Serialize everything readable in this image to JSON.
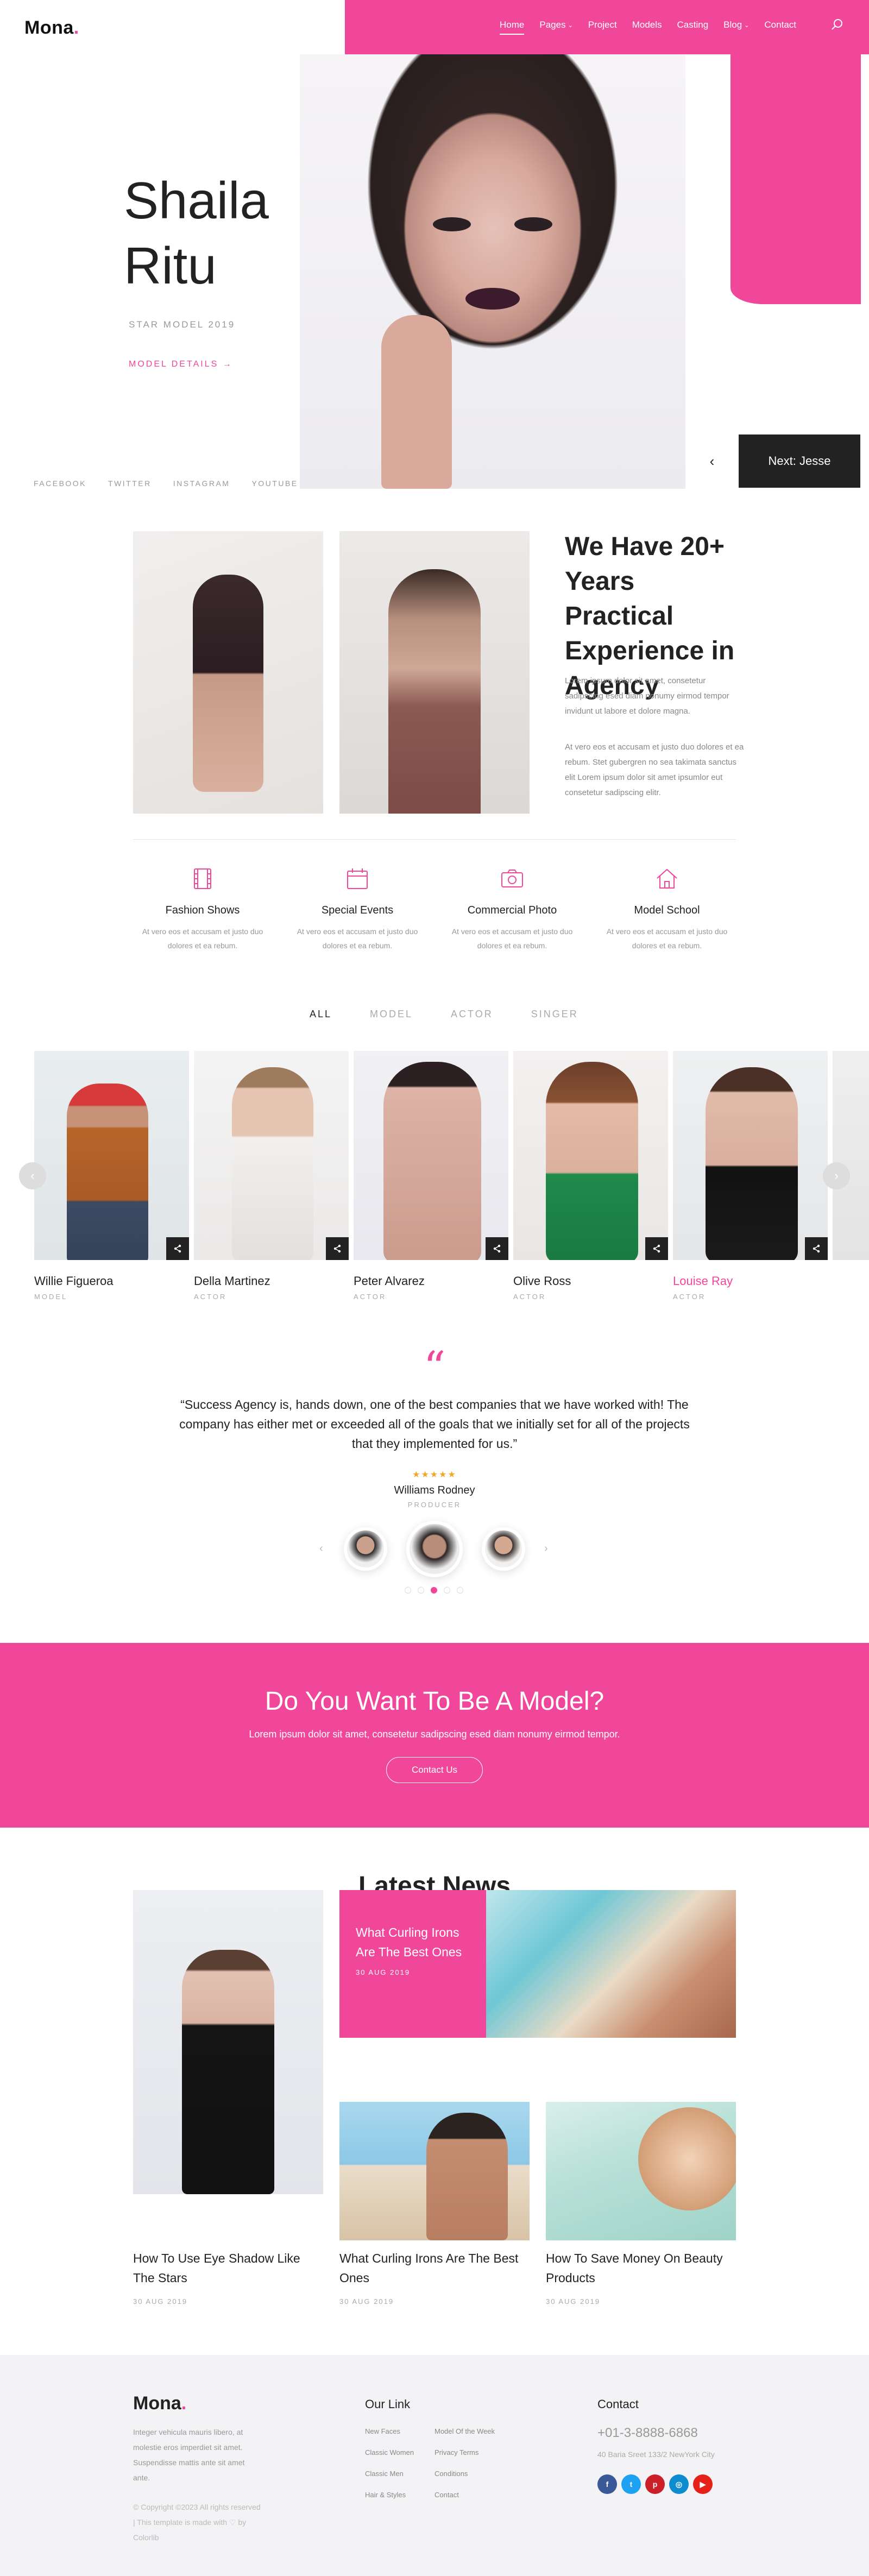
{
  "brand": {
    "logo": "Mona",
    "logo_dot": ".",
    "accent": "#f0479a"
  },
  "nav": {
    "items": [
      {
        "label": "Home",
        "active": true,
        "dropdown": false
      },
      {
        "label": "Pages",
        "active": false,
        "dropdown": true
      },
      {
        "label": "Project",
        "active": false,
        "dropdown": false
      },
      {
        "label": "Models",
        "active": false,
        "dropdown": false
      },
      {
        "label": "Casting",
        "active": false,
        "dropdown": false
      },
      {
        "label": "Blog",
        "active": false,
        "dropdown": true
      },
      {
        "label": "Contact",
        "active": false,
        "dropdown": false
      }
    ],
    "search_icon": "search-icon"
  },
  "hero": {
    "title_line1": "Shaila",
    "title_line2": "Ritu",
    "subtitle": "STAR MODEL 2019",
    "link": "MODEL DETAILS",
    "link_arrow": "→",
    "socials": [
      "FACEBOOK",
      "TWITTER",
      "INSTAGRAM",
      "YOUTUBE"
    ],
    "prev_icon": "‹",
    "next_label": "Next: Jesse"
  },
  "about": {
    "title": "We Have 20+ Years Practical Experience in Agency",
    "para1": "Lorem ipsum dolor sit amet, consetetur sadipscing esed diam nonumy eirmod tempor invidunt ut labore et dolore magna.",
    "para2": "At vero eos et accusam et justo duo dolores et ea rebum. Stet gubergren no sea takimata sanctus elit Lorem ipsum dolor sit amet ipsumlor eut consetetur sadipscing elitr."
  },
  "services": [
    {
      "icon": "film-icon",
      "title": "Fashion Shows",
      "desc": "At vero eos et accusam et justo duo dolores et ea rebum."
    },
    {
      "icon": "calendar-icon",
      "title": "Special Events",
      "desc": "At vero eos et accusam et justo duo dolores et ea rebum."
    },
    {
      "icon": "camera-icon",
      "title": "Commercial Photo",
      "desc": "At vero eos et accusam et justo duo dolores et ea rebum."
    },
    {
      "icon": "home-icon",
      "title": "Model School",
      "desc": "At vero eos et accusam et justo duo dolores et ea rebum."
    }
  ],
  "filters": [
    "ALL",
    "MODEL",
    "ACTOR",
    "SINGER"
  ],
  "models": [
    {
      "name": "Willie Figueroa",
      "role": "MODEL",
      "highlight": false
    },
    {
      "name": "Della Martinez",
      "role": "ACTOR",
      "highlight": false
    },
    {
      "name": "Peter Alvarez",
      "role": "ACTOR",
      "highlight": false
    },
    {
      "name": "Olive Ross",
      "role": "ACTOR",
      "highlight": false
    },
    {
      "name": "Louise Ray",
      "role": "ACTOR",
      "highlight": true
    }
  ],
  "testimonial": {
    "quote_mark": "“",
    "text": "“Success Agency is, hands down, one of the best companies that we have worked with! The company has either met or exceeded all of the goals that we initially set for all of the projects that they implemented for us.”",
    "stars": "★★★★★",
    "rating": 5,
    "name": "Williams Rodney",
    "role": "PRODUCER",
    "active_dot": 2,
    "dot_count": 5
  },
  "cta": {
    "title": "Do You Want To Be A Model?",
    "text": "Lorem ipsum dolor sit amet, consetetur sadipscing esed diam nonumy eirmod tempor.",
    "button": "Contact Us"
  },
  "news": {
    "title": "Latest News",
    "items": [
      {
        "title": "How To Use Eye Shadow Like The Stars",
        "date": "30 AUG 2019"
      },
      {
        "title": "What Curling Irons Are The Best Ones",
        "date": "30 AUG 2019"
      },
      {
        "title": "What Curling Irons Are The Best Ones",
        "date": "30 AUG 2019"
      },
      {
        "title": "How To Save Money On Beauty Products",
        "date": "30 AUG 2019"
      }
    ]
  },
  "footer": {
    "logo": "Mona",
    "about": "Integer vehicula mauris libero, at molestie eros imperdiet sit amet. Suspendisse mattis ante sit amet ante.",
    "copyright": "© Copyright ©2023 All rights reserved | This template is made with ♡ by Colorlib",
    "links_heading": "Our Link",
    "links_col1": [
      "New Faces",
      "Classic Women",
      "Classic Men",
      "Hair & Styles"
    ],
    "links_col2": [
      "Model Of the Week",
      "Privacy Terms",
      "Conditions",
      "Contact"
    ],
    "contact_heading": "Contact",
    "phone": "+01-3-8888-6868",
    "address": "40 Baria Sreet 133/2 NewYork City",
    "social": [
      {
        "icon": "facebook-icon",
        "glyph": "f",
        "color": "#3b5998"
      },
      {
        "icon": "twitter-icon",
        "glyph": "t",
        "color": "#1da1f2"
      },
      {
        "icon": "pinterest-icon",
        "glyph": "p",
        "color": "#cb2027"
      },
      {
        "icon": "instagram-icon",
        "glyph": "◎",
        "color": "#0e8ccf"
      },
      {
        "icon": "youtube-icon",
        "glyph": "▶",
        "color": "#e62117"
      }
    ]
  }
}
